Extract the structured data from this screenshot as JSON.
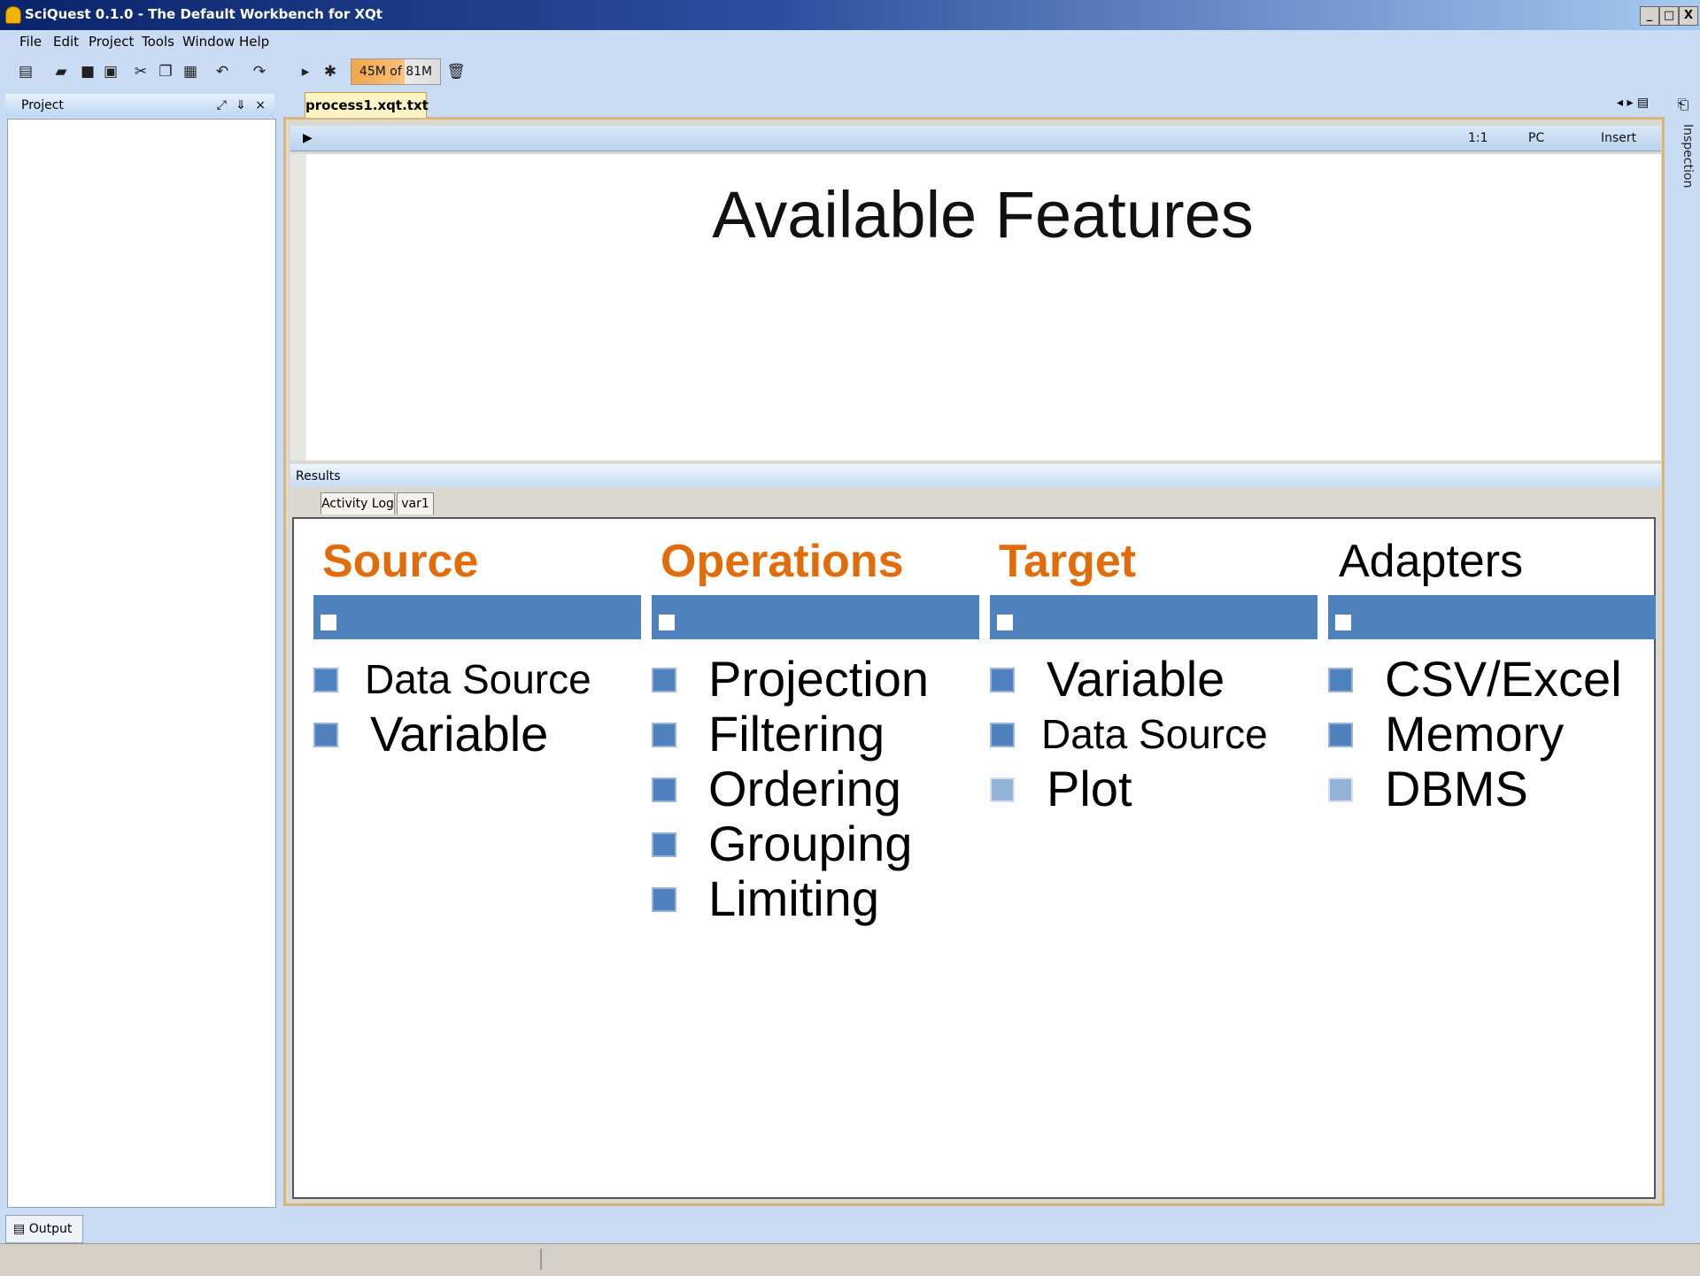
{
  "window": {
    "title": "SciQuest 0.1.0 - The Default Workbench for XQt",
    "controls": [
      "_",
      "□",
      "X"
    ]
  },
  "menu": [
    "File",
    "Edit",
    "Project",
    "Tools",
    "Window",
    "Help"
  ],
  "toolbar": {
    "memory": "45M of 81M"
  },
  "project_panel": {
    "title": "Project"
  },
  "editor": {
    "tab": "process1.xqt.txt",
    "status": {
      "position": "1:1",
      "line_ending": "PC",
      "mode": "Insert"
    },
    "heading": "Available Features"
  },
  "results": {
    "title": "Results",
    "tabs": [
      "Activity Log",
      "var1"
    ],
    "columns": [
      {
        "title": "Source",
        "items": [
          "Data Source",
          "Variable"
        ]
      },
      {
        "title": "Operations",
        "items": [
          "Projection",
          "Filtering",
          "Ordering",
          "Grouping",
          "Limiting"
        ]
      },
      {
        "title": "Target",
        "items": [
          "Variable",
          "Data Source",
          "Plot"
        ]
      },
      {
        "title": "Adapters",
        "items": [
          "CSV/Excel",
          "Memory",
          "DBMS"
        ]
      }
    ]
  },
  "right_dock": {
    "label": "Inspection"
  },
  "bottom": {
    "output_label": "Output"
  },
  "colors": {
    "accent_orange": "#e36c0a",
    "bar_blue": "#4f81bd",
    "bullet_light": "#95b3d7"
  }
}
